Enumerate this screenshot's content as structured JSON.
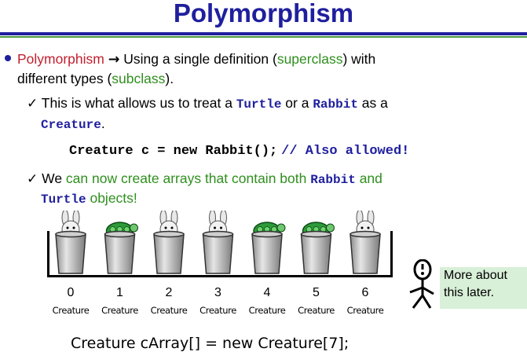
{
  "slide": {
    "title": "Polymorphism",
    "bullet1": {
      "term": "Polymorphism",
      "arrow": "→",
      "text_a": " Using a single definition (",
      "superclass": "superclass",
      "text_b": ") with",
      "line2_a": "different types (",
      "subclass": "subclass",
      "line2_b": ")."
    },
    "check1": {
      "mark": "✓",
      "text_a": "This is what allows us to treat a ",
      "code_turtle": "Turtle",
      "text_b": " or a ",
      "code_rabbit": "Rabbit",
      "text_c": " as a",
      "code_creature": "Creature",
      "text_d": "."
    },
    "code_line1": {
      "code": "Creature c = new Rabbit();",
      "comment": "// Also allowed!"
    },
    "check2": {
      "mark": "✓",
      "text_a": "We ",
      "green_a": "can now create arrays that contain both ",
      "code_rabbit": "Rabbit",
      "green_b": " and",
      "code_turtle": "Turtle",
      "green_c": " objects!"
    },
    "array": {
      "contents": [
        "rabbit",
        "turtle",
        "rabbit",
        "rabbit",
        "turtle",
        "turtle",
        "rabbit"
      ],
      "indices": [
        "0",
        "1",
        "2",
        "3",
        "4",
        "5",
        "6"
      ],
      "labels": [
        "Creature",
        "Creature",
        "Creature",
        "Creature",
        "Creature",
        "Creature",
        "Creature"
      ]
    },
    "note": {
      "line1": "More about",
      "line2": "this later."
    },
    "code_line2": "Creature cArray[] = new Creature[7];",
    "colors": {
      "title": "#1f1f9e",
      "term": "#c0202e",
      "green": "#2f8f1e",
      "note_bg": "#d8efd8"
    }
  }
}
